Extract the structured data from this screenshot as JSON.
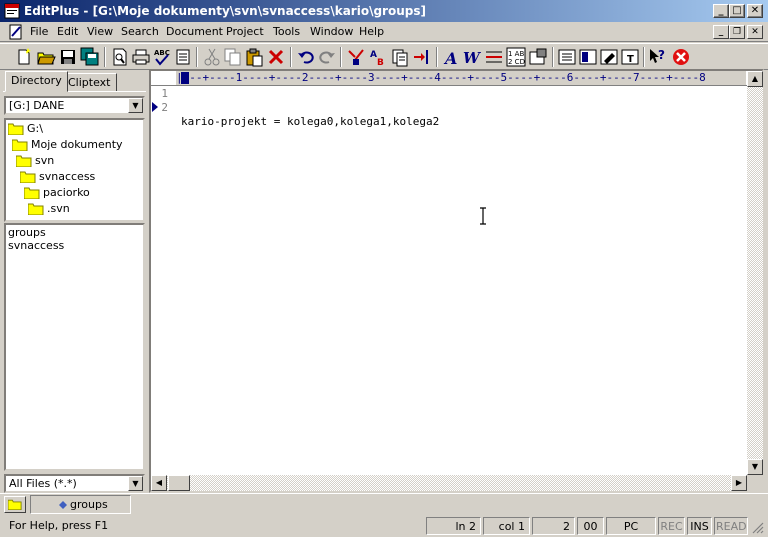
{
  "window": {
    "title": "EditPlus - [G:\\Moje dokumenty\\svn\\svnaccess\\kario\\groups]"
  },
  "menu": [
    "File",
    "Edit",
    "View",
    "Search",
    "Document",
    "Project",
    "Tools",
    "Window",
    "Help"
  ],
  "sidebar": {
    "tabs": [
      "Directory",
      "Cliptext"
    ],
    "drive": "[G:] DANE",
    "tree": [
      "G:\\",
      "Moje dokumenty",
      "svn",
      "svnaccess",
      "paciorko",
      ".svn"
    ],
    "files": [
      "groups",
      "svnaccess"
    ],
    "filter": "All Files (*.*)"
  },
  "editor": {
    "ruler": "|---+----1----+----2----+----3----+----4----+----5----+----6----+----7----+----8",
    "line_numbers": [
      "1",
      "2"
    ],
    "lines": [
      "kario-projekt = kolega0,kolega1,kolega2",
      ""
    ]
  },
  "doc_tab": {
    "label": "groups"
  },
  "status": {
    "help": "For Help, press F1",
    "line": "ln 2",
    "col": "col 1",
    "num1": "2",
    "num2": "00",
    "mode": "PC",
    "rec": "REC",
    "ins": "INS",
    "read": "READ"
  }
}
